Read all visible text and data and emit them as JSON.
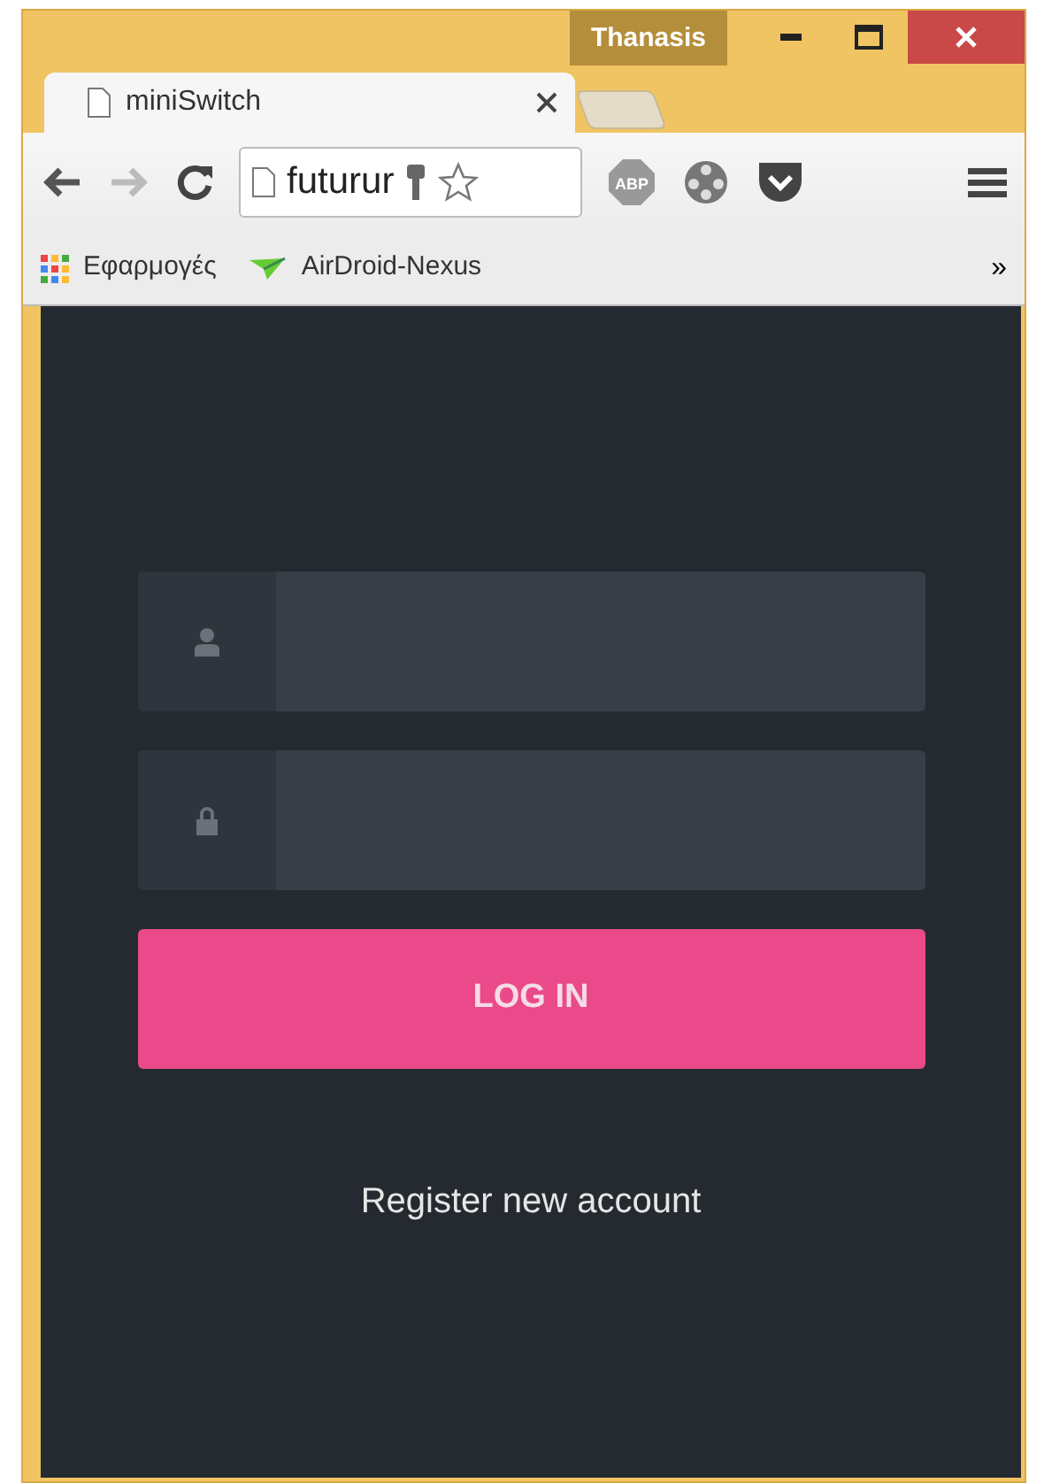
{
  "window": {
    "user": "Thanasis"
  },
  "tabs": [
    {
      "title": "miniSwitch",
      "selected": true
    }
  ],
  "address_bar": {
    "value": "futurur",
    "extension_badge": "ABP"
  },
  "bookmarks": [
    {
      "kind": "apps",
      "label": "Εφαρμογές"
    },
    {
      "kind": "plane",
      "label": "AirDroid-Nexus"
    }
  ],
  "bookmarks_overflow": "»",
  "login": {
    "fields": [
      {
        "kind": "user"
      },
      {
        "kind": "password"
      }
    ],
    "button": "LOG IN",
    "register_link": "Register new account"
  }
}
